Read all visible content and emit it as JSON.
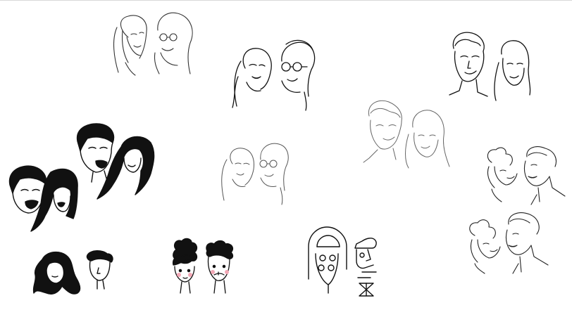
{
  "canvas": {
    "background": "#ffffff",
    "border_color": "#d8d8d8"
  },
  "colors": {
    "ink": "#111111",
    "ink_light": "#444444",
    "ink_faint": "#777777",
    "cheek": "#f2a7b5"
  },
  "sketches": [
    {
      "id": "couple-sketch-1",
      "style": "thin line portrait, woman laughing and older woman with glasses"
    },
    {
      "id": "couple-sketch-2",
      "style": "line portrait, woman laughing and older woman with glasses"
    },
    {
      "id": "couple-sketch-3",
      "style": "line portrait, man and woman smiling"
    },
    {
      "id": "couple-sketch-4",
      "style": "faint sketch portrait, man and woman smiling"
    },
    {
      "id": "couple-sketch-5",
      "style": "faint line portrait, woman laughing and older woman with glasses"
    },
    {
      "id": "couple-sketch-6",
      "style": "bold filled portrait, man and woman laughing"
    },
    {
      "id": "couple-sketch-7",
      "style": "bold filled portrait, man and woman laughing"
    },
    {
      "id": "couple-sketch-8",
      "style": "line portrait, woman with updo and man laughing"
    },
    {
      "id": "couple-sketch-9",
      "style": "line portrait, woman with updo and man laughing"
    },
    {
      "id": "couple-sketch-10",
      "style": "minimal silhouette, woman with black hair and man"
    },
    {
      "id": "couple-sketch-11",
      "style": "minimal portrait, curly hair couple with pink cheeks"
    },
    {
      "id": "couple-sketch-12",
      "style": "abstract geometric faces"
    }
  ]
}
